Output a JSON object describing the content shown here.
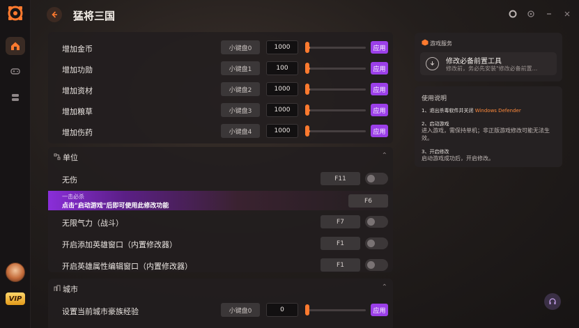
{
  "app": {
    "title": "猛将三国",
    "nav": [
      "home-icon",
      "gamepad-icon",
      "database-icon"
    ],
    "vip_label": "VIP",
    "accent": "#ff7a2f",
    "apply_color": "#9b3fe8"
  },
  "resource_rows": [
    {
      "label": "增加金币",
      "hotkey": "小键盘0",
      "value": "1000",
      "apply": "应用"
    },
    {
      "label": "增加功勋",
      "hotkey": "小键盘1",
      "value": "100",
      "apply": "应用"
    },
    {
      "label": "增加资材",
      "hotkey": "小键盘2",
      "value": "1000",
      "apply": "应用"
    },
    {
      "label": "增加粮草",
      "hotkey": "小键盘3",
      "value": "1000",
      "apply": "应用"
    },
    {
      "label": "增加伤药",
      "hotkey": "小键盘4",
      "value": "1000",
      "apply": "应用"
    }
  ],
  "unit_section": {
    "title": "单位",
    "rows": [
      {
        "label": "无伤",
        "key": "F11"
      },
      {
        "label": "无限气力（战斗）",
        "key": "F7"
      },
      {
        "label": "开启添加英雄窗口（内置修改器）",
        "key": "F1"
      },
      {
        "label": "开启英雄属性编辑窗口（内置修改器）",
        "key": "F1"
      }
    ],
    "promo": {
      "small": "一击必杀",
      "main": "点击\"启动游戏\"后即可使用此修改功能",
      "key": "F6"
    }
  },
  "city_section": {
    "title": "城市",
    "row": {
      "label": "设置当前城市豪族经验",
      "hotkey": "小键盘0",
      "value": "0",
      "apply": "应用"
    }
  },
  "services": {
    "title": "游戏服务",
    "tool_name": "修改必备前置工具",
    "tool_desc": "修改前，务必先安装\"修改必备前置..."
  },
  "guide": {
    "title": "使用说明",
    "step1_title": "1、退出杀毒软件并关闭",
    "step1_highlight": "Windows Defender",
    "step2_title": "2、启动游戏",
    "step2_desc": "进入游戏，需保持单机；非正版游戏修改可能无法生效。",
    "step3_title": "3、开启修改",
    "step3_desc": "启动游戏成功后，开启修改。"
  }
}
